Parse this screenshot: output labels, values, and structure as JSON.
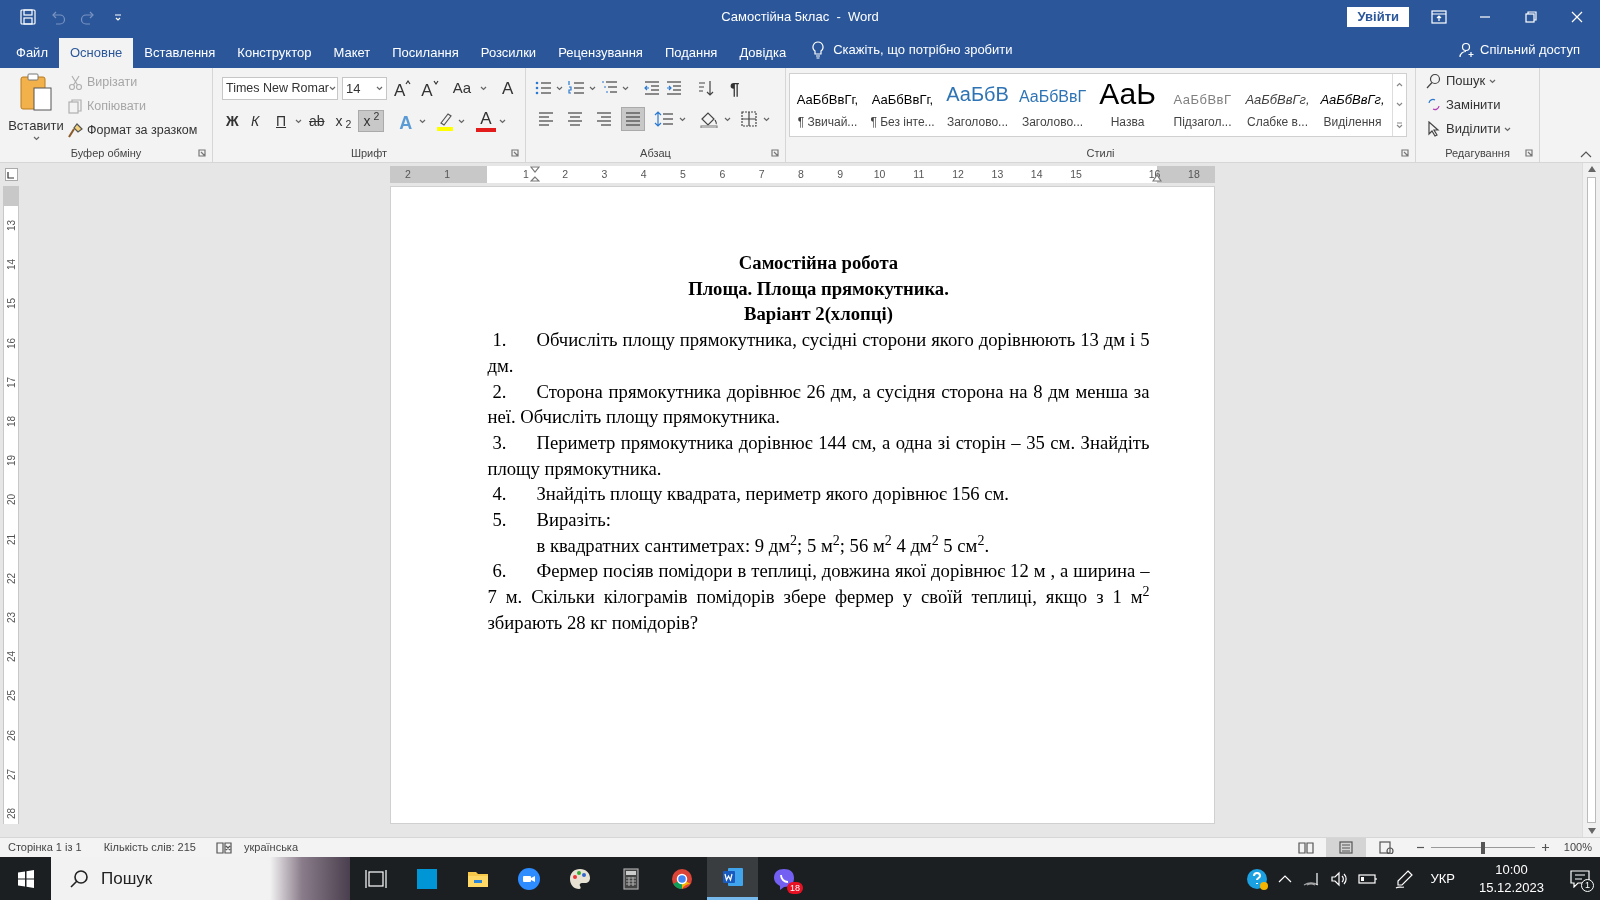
{
  "window": {
    "title": "Самостійна 5клас  -  Word",
    "sign_in": "Увійти"
  },
  "quick_access": [
    {
      "kind": "save",
      "disabled": false
    },
    {
      "kind": "undo",
      "disabled": true
    },
    {
      "kind": "redo",
      "disabled": true
    },
    {
      "kind": "customize",
      "disabled": false
    }
  ],
  "tabs": [
    {
      "label": "Файл",
      "selected": false
    },
    {
      "label": "Основне",
      "selected": true
    },
    {
      "label": "Вставлення",
      "selected": false
    },
    {
      "label": "Конструктор",
      "selected": false
    },
    {
      "label": "Макет",
      "selected": false
    },
    {
      "label": "Посилання",
      "selected": false
    },
    {
      "label": "Розсилки",
      "selected": false
    },
    {
      "label": "Рецензування",
      "selected": false
    },
    {
      "label": "Подання",
      "selected": false
    },
    {
      "label": "Довідка",
      "selected": false
    }
  ],
  "tell_me": "Скажіть, що потрібно зробити",
  "share": "Спільний доступ",
  "ribbon": {
    "clipboard": {
      "title": "Буфер обміну",
      "paste": "Вставити",
      "items": [
        {
          "kind": "cut",
          "label": "Вирізати",
          "disabled": true
        },
        {
          "kind": "copy",
          "label": "Копіювати",
          "disabled": true
        },
        {
          "kind": "format_painter",
          "label": "Формат за зразком",
          "disabled": false
        }
      ]
    },
    "font": {
      "title": "Шрифт",
      "font_name": "Times New Romar",
      "font_size": "14",
      "size_buttons": [
        {
          "kind": "grow",
          "label": "A"
        },
        {
          "kind": "shrink",
          "label": "A"
        }
      ],
      "change_case": "Aa",
      "clear_formatting": "A",
      "format_buttons": [
        {
          "kind": "bold",
          "label": "Ж",
          "selected": false
        },
        {
          "kind": "italic",
          "label": "К",
          "selected": false
        },
        {
          "kind": "underline",
          "label": "П",
          "selected": false
        },
        {
          "kind": "strikethrough",
          "label": "ab",
          "selected": false
        },
        {
          "kind": "subscript",
          "label": "x$_{2}$",
          "selected": false
        },
        {
          "kind": "superscript",
          "label": "x$^{2}$",
          "selected": true
        }
      ],
      "text_effects": "A",
      "font_color": "A"
    },
    "paragraph": {
      "title": "Абзац",
      "show_marks": "¶",
      "alignment": [
        {
          "kind": "left",
          "selected": false
        },
        {
          "kind": "center",
          "selected": false
        },
        {
          "kind": "right",
          "selected": false
        },
        {
          "kind": "justify",
          "selected": true
        }
      ]
    },
    "styles": {
      "title": "Стилі",
      "items": [
        {
          "kind": "normal",
          "preview": "АаБбВвГг,",
          "label": "¶ Звичай..."
        },
        {
          "kind": "no_spacing",
          "preview": "АаБбВвГг,",
          "label": "¶ Без інте..."
        },
        {
          "kind": "heading1",
          "preview": "АаБбВ",
          "label": "Заголово..."
        },
        {
          "kind": "heading2",
          "preview": "АаБбВвГ",
          "label": "Заголово..."
        },
        {
          "kind": "title",
          "preview": "АаЬ",
          "label": "Назва"
        },
        {
          "kind": "subtitle",
          "preview": "АаБбВвГ",
          "label": "Підзагол..."
        },
        {
          "kind": "subtle_emphasis",
          "preview": "АаБбВвГг,",
          "label": "Слабке в..."
        },
        {
          "kind": "emphasis",
          "preview": "АаБбВвГг,",
          "label": "Виділення"
        }
      ]
    },
    "editing": {
      "title": "Редагування",
      "items": [
        {
          "kind": "find",
          "label": "Пошук"
        },
        {
          "kind": "replace",
          "label": "Замінити"
        },
        {
          "kind": "select",
          "label": "Виділити"
        }
      ]
    }
  },
  "horizontal_ruler": [
    "2",
    "1",
    "1",
    "2",
    "3",
    "4",
    "5",
    "6",
    "7",
    "8",
    "9",
    "10",
    "11",
    "12",
    "13",
    "14",
    "15",
    "16",
    "18"
  ],
  "vertical_ruler": [
    "13",
    "14",
    "15",
    "16",
    "17",
    "18",
    "19",
    "20",
    "21",
    "22",
    "23",
    "24",
    "25",
    "26",
    "27",
    "28"
  ],
  "document": {
    "headings": [
      "Самостійна робота",
      "Площа. Площа прямокутника.",
      "Варіант 2(хлопці)"
    ],
    "list": [
      {
        "number": "1.",
        "text": "Обчисліть площу прямокутника, сусідні сторони якого дорівнюють 13 дм і 5 дм."
      },
      {
        "number": "2.",
        "text": "Сторона прямокутника дорівнює 26 дм, а сусідня сторона на 8 дм менша за неї. Обчисліть площу прямокутника."
      },
      {
        "number": "3.",
        "text": "Периметр прямокутника дорівнює 144 см, а одна зі сторін – 35 см. Знайдіть площу прямокутника."
      },
      {
        "number": "4.",
        "text": "Знайдіть площу квадрата, периметр якого дорівнює 156 см."
      },
      {
        "number": "5.",
        "text": "Виразіть:",
        "continuation": "в квадратних сантиметрах: 9 дм$^{2}$; 5 м$^{2}$; 56 м$^{2}$ 4 дм$^{2}$ 5 см$^{2}$."
      },
      {
        "number": "6.",
        "text": "Фермер посіяв помідори в теплиці, довжина якої дорівнює 12 м , а ширина – 7 м.  Скільки кілограмів помідорів збере фермер у своїй теплиці, якщо з 1 м$^{2}$ збирають 28 кг помідорів?"
      }
    ]
  },
  "status_bar": {
    "page": "Сторінка 1 із 1",
    "words": "Кількість слів: 215",
    "language": "українська",
    "views": [
      {
        "kind": "read",
        "selected": false
      },
      {
        "kind": "print",
        "selected": true
      },
      {
        "kind": "web",
        "selected": false
      }
    ],
    "zoom": {
      "level": 0.5,
      "reading": "100%"
    }
  },
  "taskbar": {
    "search_placeholder": "Пошук",
    "apps": [
      {
        "kind": "task_view",
        "active": false
      },
      {
        "kind": "myhp",
        "active": false
      },
      {
        "kind": "explorer",
        "active": false
      },
      {
        "kind": "zoom",
        "active": false
      },
      {
        "kind": "paint",
        "active": false
      },
      {
        "kind": "calculator",
        "active": false
      },
      {
        "kind": "chrome",
        "active": false
      },
      {
        "kind": "word",
        "active": true
      },
      {
        "kind": "viber",
        "active": false,
        "badge": "18"
      }
    ],
    "language": "УКР",
    "time": "10:00",
    "date": "15.12.2023",
    "notifications": "1"
  }
}
